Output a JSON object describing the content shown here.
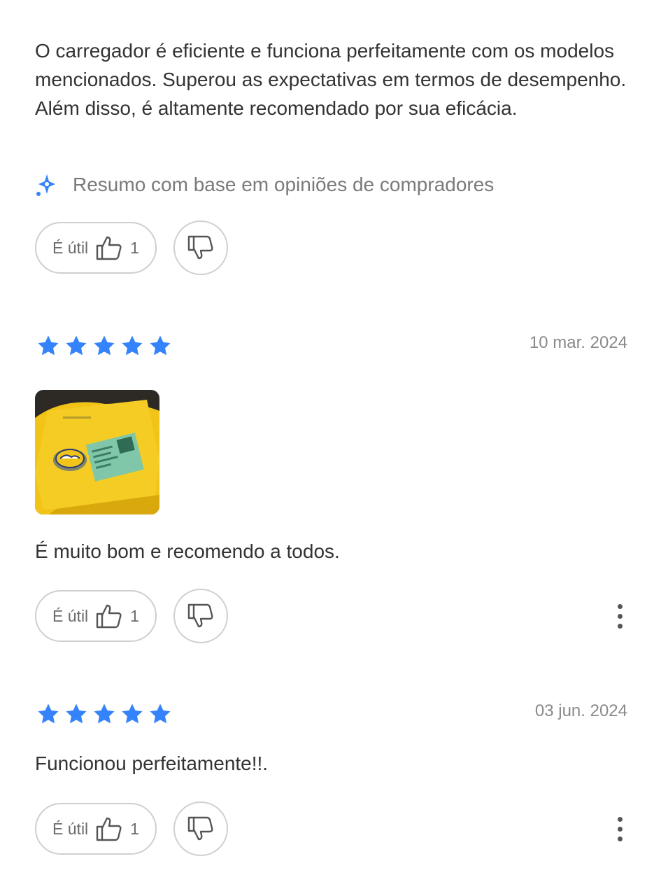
{
  "summary": {
    "text": "O carregador é eficiente e funciona perfeitamente com os modelos mencionados. Superou as expectativas em termos de desempenho. Além disso, é altamente recomendado por sua eficácia.",
    "ai_note": "Resumo com base em opiniões de compradores",
    "useful_label": "É útil",
    "useful_count": "1"
  },
  "reviews": [
    {
      "rating": 5,
      "date": "10 mar. 2024",
      "text": "É muito bom e recomendo a todos.",
      "useful_label": "É útil",
      "useful_count": "1",
      "has_photo": true
    },
    {
      "rating": 5,
      "date": "03 jun. 2024",
      "text": "Funcionou perfeitamente!!.",
      "useful_label": "É útil",
      "useful_count": "1",
      "has_photo": false
    }
  ],
  "colors": {
    "star": "#3483fa",
    "ai_icon": "#3483fa",
    "package": "#f2c417",
    "label": "#7fc7a8"
  }
}
